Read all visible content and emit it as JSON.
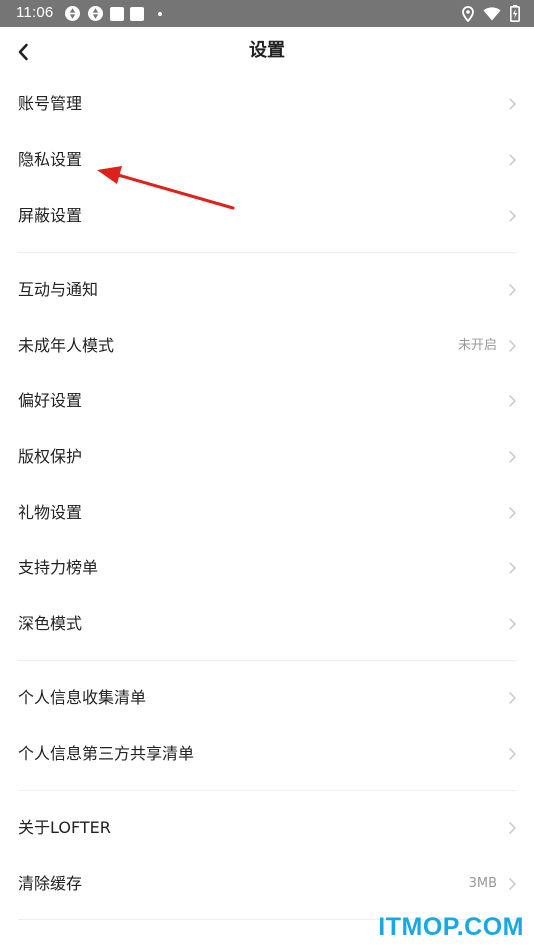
{
  "status_bar": {
    "time": "11:06",
    "left_icons": [
      "sync-icon",
      "sync-icon",
      "notification-square-icon",
      "notification-square-icon",
      "dot-icon"
    ],
    "right_icons": [
      "location-icon",
      "wifi-icon",
      "battery-charging-icon"
    ]
  },
  "header": {
    "title": "设置",
    "back_icon": "chevron-left-icon"
  },
  "groups": [
    {
      "items": [
        {
          "label": "账号管理",
          "value": ""
        },
        {
          "label": "隐私设置",
          "value": ""
        },
        {
          "label": "屏蔽设置",
          "value": ""
        }
      ]
    },
    {
      "items": [
        {
          "label": "互动与通知",
          "value": ""
        },
        {
          "label": "未成年人模式",
          "value": "未开启"
        },
        {
          "label": "偏好设置",
          "value": ""
        },
        {
          "label": "版权保护",
          "value": ""
        },
        {
          "label": "礼物设置",
          "value": ""
        },
        {
          "label": "支持力榜单",
          "value": ""
        },
        {
          "label": "深色模式",
          "value": ""
        }
      ]
    },
    {
      "items": [
        {
          "label": "个人信息收集清单",
          "value": ""
        },
        {
          "label": "个人信息第三方共享清单",
          "value": ""
        }
      ]
    },
    {
      "items": [
        {
          "label": "关于LOFTER",
          "value": ""
        },
        {
          "label": "清除缓存",
          "value": "3MB"
        }
      ]
    }
  ],
  "colors": {
    "status_bar": "#757575",
    "text_primary": "#222222",
    "text_secondary": "#999999",
    "chevron": "#c8c8c8",
    "divider": "#eeeeee",
    "annotation_arrow": "#e0201b",
    "watermark": "#1aa7e6"
  },
  "watermark": "ITMOP.COM"
}
